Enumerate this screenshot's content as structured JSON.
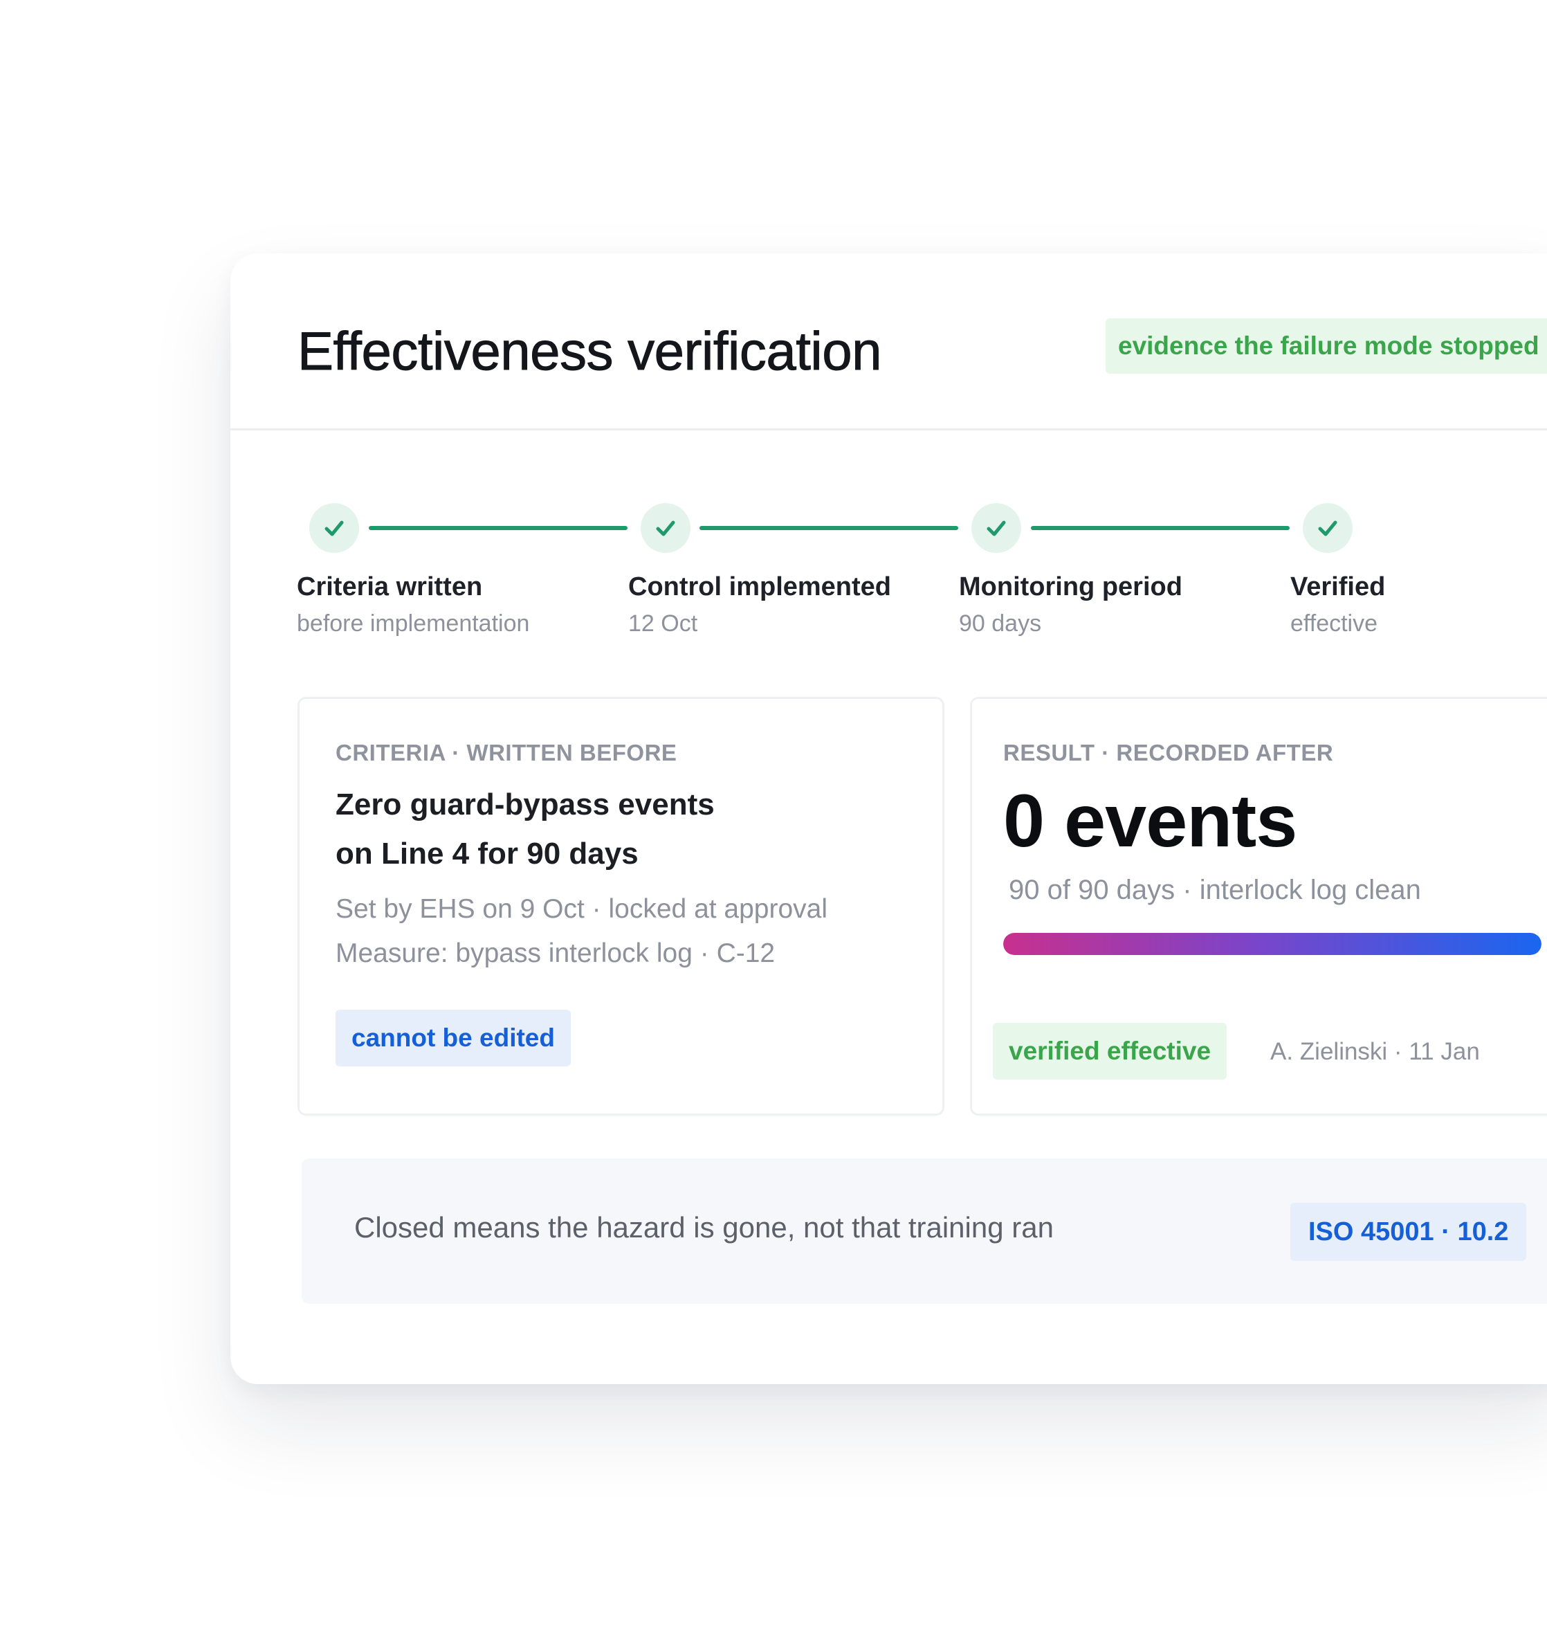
{
  "header": {
    "title": "Effectiveness verification",
    "tag": "evidence the failure mode stopped"
  },
  "stepper": {
    "steps": [
      {
        "title": "Criteria written",
        "subtitle": "before implementation",
        "status": "complete",
        "icon": "check-icon"
      },
      {
        "title": "Control implemented",
        "subtitle": "12 Oct",
        "status": "complete",
        "icon": "check-icon"
      },
      {
        "title": "Monitoring period",
        "subtitle": "90 days",
        "status": "complete",
        "icon": "check-icon"
      },
      {
        "title": "Verified",
        "subtitle": "effective",
        "status": "complete",
        "icon": "check-icon"
      }
    ]
  },
  "criteria": {
    "eyebrow": "CRITERIA · WRITTEN BEFORE",
    "line1": "Zero guard-bypass events",
    "line2": "on Line 4 for 90 days",
    "meta1": "Set by EHS on 9 Oct · locked at approval",
    "meta2": "Measure: bypass interlock log · C-12",
    "badge": "cannot be edited"
  },
  "result": {
    "eyebrow": "RESULT · RECORDED AFTER",
    "value": "0 events",
    "meta": "90 of 90 days · interlock log clean",
    "progress": 1.0,
    "badge": "verified effective",
    "verifier": "A. Zielinski · 11 Jan"
  },
  "note": {
    "text": "Closed means the hazard is gone, not that training ran",
    "reference": "ISO 45001 · 10.2"
  },
  "colors": {
    "success": "#1f9a6a",
    "success_bg": "#e4f4ec",
    "green_text": "#3aa54a",
    "blue_text": "#1560d6",
    "gradient_start": "#c8308e",
    "gradient_end": "#1a66f0"
  }
}
